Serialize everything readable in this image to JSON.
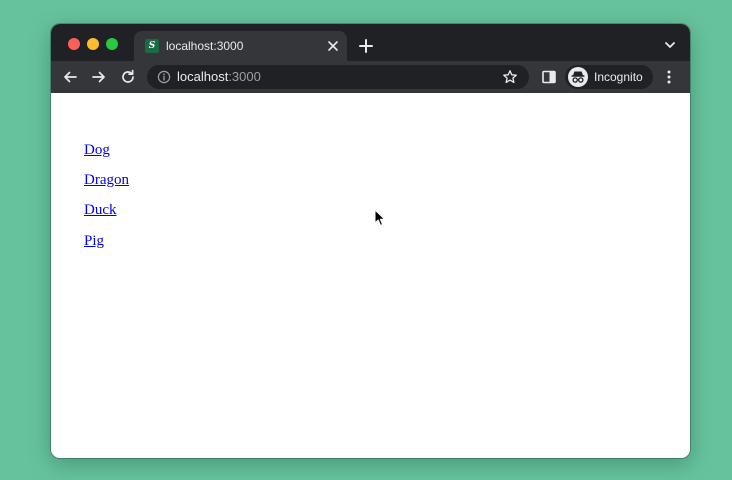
{
  "browser": {
    "tab": {
      "favicon_letter": "S",
      "title": "localhost:3000"
    },
    "address_bar": {
      "host": "localhost",
      "port": ":3000"
    },
    "profile": {
      "label": "Incognito"
    },
    "icons": {
      "close_window": "red-traffic-light",
      "minimize_window": "yellow-traffic-light",
      "maximize_window": "green-traffic-light",
      "tab_close": "close-icon",
      "new_tab": "plus-icon",
      "tab_search": "chevron-down-icon",
      "back": "arrow-left-icon",
      "forward": "arrow-right-icon",
      "reload": "reload-icon",
      "site_info": "info-icon",
      "bookmark": "star-icon",
      "side_panel": "side-panel-icon",
      "incognito": "incognito-icon",
      "menu": "kebab-menu-icon"
    }
  },
  "page": {
    "links": [
      {
        "label": "Dog"
      },
      {
        "label": "Dragon"
      },
      {
        "label": "Duck"
      },
      {
        "label": "Pig"
      }
    ]
  },
  "colors": {
    "background": "#66c29d",
    "chrome_dark": "#202124",
    "chrome_toolbar": "#35363a",
    "link": "#0000ee"
  }
}
